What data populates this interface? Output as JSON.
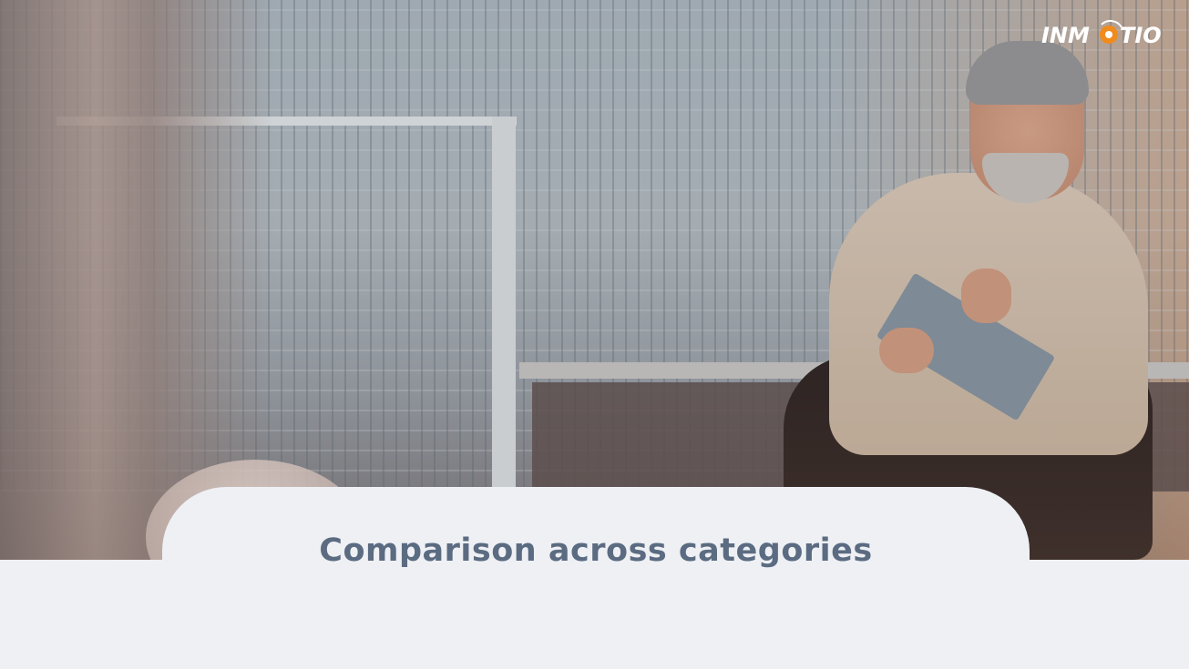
{
  "slide": {
    "title": "Comparison across categories"
  },
  "logo": {
    "text_left": "INM",
    "text_right": "TIO",
    "accent_color": "#f08c1e"
  },
  "colors": {
    "title": "#5b6b81",
    "panel_background": "#eef0f4"
  }
}
